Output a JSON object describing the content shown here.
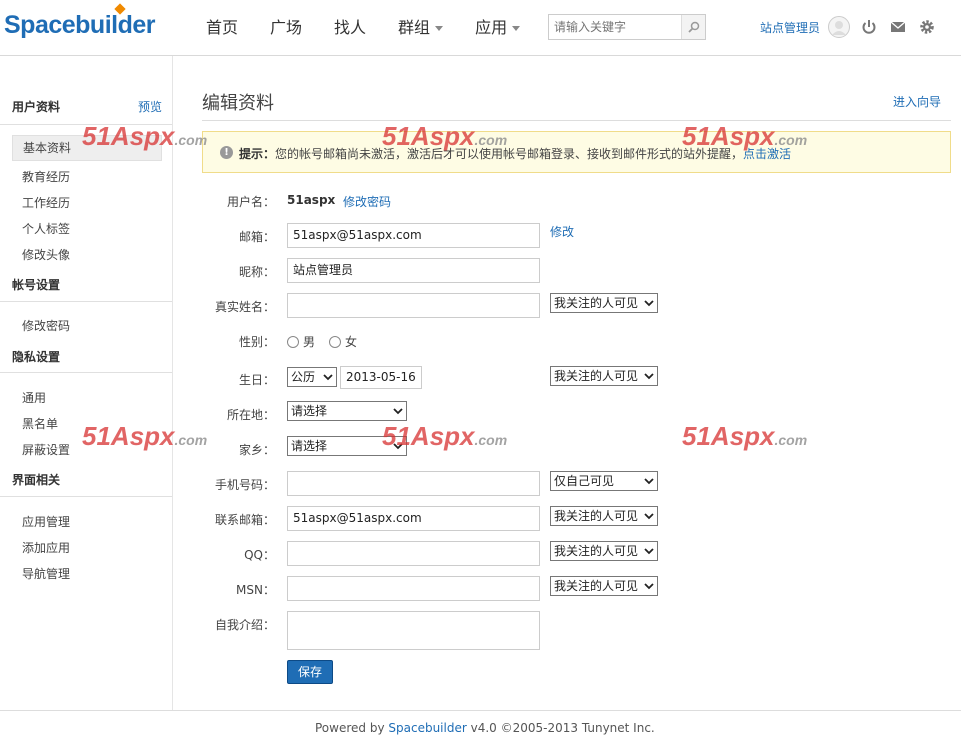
{
  "header": {
    "logo": "Spacebuilder",
    "nav": [
      "首页",
      "广场",
      "找人",
      "群组",
      "应用"
    ],
    "nav_dropdown": [
      false,
      false,
      false,
      true,
      true
    ],
    "search_placeholder": "请输入关键字",
    "user_name": "站点管理员"
  },
  "sidebar": {
    "profile_heading": "用户资料",
    "preview_link": "预览",
    "profile_items": [
      "基本资料",
      "教育经历",
      "工作经历",
      "个人标签",
      "修改头像"
    ],
    "account_heading": "帐号设置",
    "account_items": [
      "修改密码"
    ],
    "privacy_heading": "隐私设置",
    "privacy_items": [
      "通用",
      "黑名单",
      "屏蔽设置"
    ],
    "ui_heading": "界面相关",
    "ui_items": [
      "应用管理",
      "添加应用",
      "导航管理"
    ]
  },
  "main": {
    "title": "编辑资料",
    "wizard_link": "进入向导",
    "notice": {
      "label": "提示：",
      "text": "您的帐号邮箱尚未激活，激活后才可以使用帐号邮箱登录、接收到邮件形式的站外提醒，",
      "link": "点击激活"
    },
    "form": {
      "username_label": "用户名：",
      "username_value": "51aspx",
      "change_password_link": "修改密码",
      "email_label": "邮箱：",
      "email_value": "51aspx@51aspx.com",
      "email_edit_link": "修改",
      "nickname_label": "昵称：",
      "nickname_value": "站点管理员",
      "realname_label": "真实姓名：",
      "realname_privacy": "我关注的人可见",
      "gender_label": "性别：",
      "gender_male": "男",
      "gender_female": "女",
      "birthday_label": "生日：",
      "birthday_calendar": "公历",
      "birthday_value": "2013-05-16",
      "birthday_privacy": "我关注的人可见",
      "location_label": "所在地：",
      "location_value": "请选择",
      "hometown_label": "家乡：",
      "hometown_value": "请选择",
      "mobile_label": "手机号码：",
      "mobile_privacy": "仅自己可见",
      "contact_email_label": "联系邮箱：",
      "contact_email_value": "51aspx@51aspx.com",
      "contact_email_privacy": "我关注的人可见",
      "qq_label": "QQ：",
      "qq_privacy": "我关注的人可见",
      "msn_label": "MSN：",
      "msn_privacy": "我关注的人可见",
      "intro_label": "自我介绍：",
      "save_label": "保存"
    }
  },
  "footer": {
    "prefix": "Powered by",
    "brand": "Spacebuilder",
    "suffix": "v4.0 ©2005-2013 Tunynet Inc."
  },
  "watermark": {
    "text": "51Aspx",
    "domain": ".com"
  },
  "colors": {
    "link": "#1f6db5",
    "notice_bg": "#fefce4",
    "button": "#1f6db5"
  }
}
